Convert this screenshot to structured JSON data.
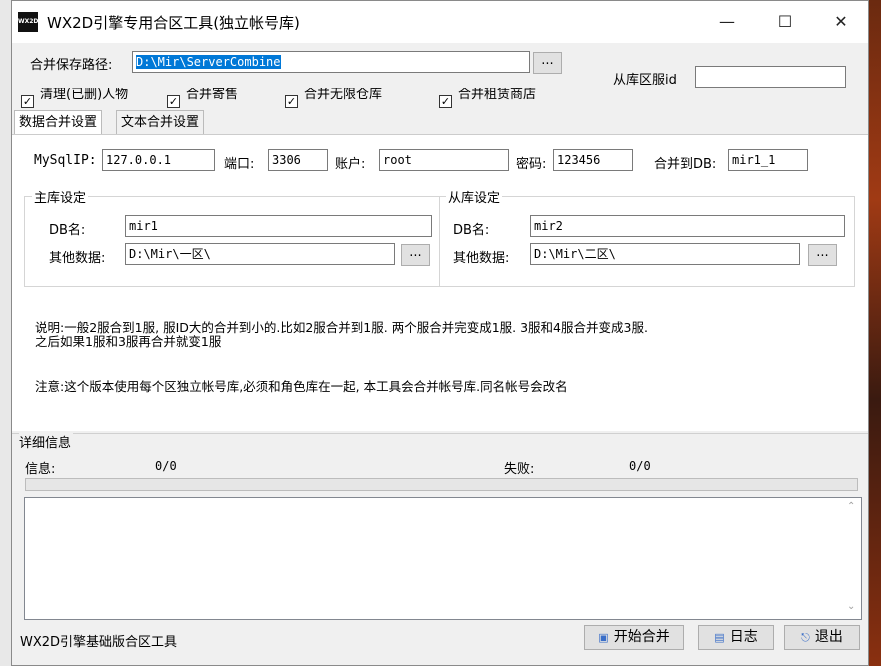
{
  "window": {
    "title": "WX2D引擎专用合区工具(独立帐号库)",
    "logo_text": "WX2D"
  },
  "path": {
    "label": "合并保存路径:",
    "value": "D:\\Mir\\ServerCombine",
    "browse": "..."
  },
  "slave_server_id": {
    "label": "从库区服id",
    "value": ""
  },
  "checkboxes": [
    {
      "label": "清理(已删)人物",
      "checked": true
    },
    {
      "label": "合并寄售",
      "checked": true
    },
    {
      "label": "合并无限仓库",
      "checked": true
    },
    {
      "label": "合并租赁商店",
      "checked": true
    }
  ],
  "tabs": [
    {
      "label": "数据合并设置",
      "active": true
    },
    {
      "label": "文本合并设置",
      "active": false
    }
  ],
  "conn": {
    "ip_label": "MySqlIP:",
    "ip": "127.0.0.1",
    "port_label": "端口:",
    "port": "3306",
    "user_label": "账户:",
    "user": "root",
    "pwd_label": "密码:",
    "pwd": "123456",
    "target_label": "合并到DB:",
    "target": "mir1_1"
  },
  "master": {
    "title": "主库设定",
    "db_label": "DB名:",
    "db": "mir1",
    "other_label": "其他数据:",
    "other": "D:\\Mir\\一区\\",
    "browse": "..."
  },
  "slave": {
    "title": "从库设定",
    "db_label": "DB名:",
    "db": "mir2",
    "other_label": "其他数据:",
    "other": "D:\\Mir\\二区\\",
    "browse": "..."
  },
  "notes": {
    "line1": "说明:一般2服合到1服, 服ID大的合并到小的.比如2服合并到1服. 两个服合并完变成1服. 3服和4服合并变成3服.",
    "line2": "之后如果1服和3服再合并就变1服",
    "line3": "注意:这个版本使用每个区独立帐号库,必须和角色库在一起, 本工具会合并帐号库.同名帐号会改名"
  },
  "details": {
    "title": "详细信息",
    "info_label": "信息:",
    "info_value": "0/0",
    "fail_label": "失败:",
    "fail_value": "0/0",
    "progress": 0,
    "log_text": ""
  },
  "footer": {
    "status": "WX2D引擎基础版合区工具",
    "start": "开始合并",
    "log": "日志",
    "exit": "退出"
  }
}
